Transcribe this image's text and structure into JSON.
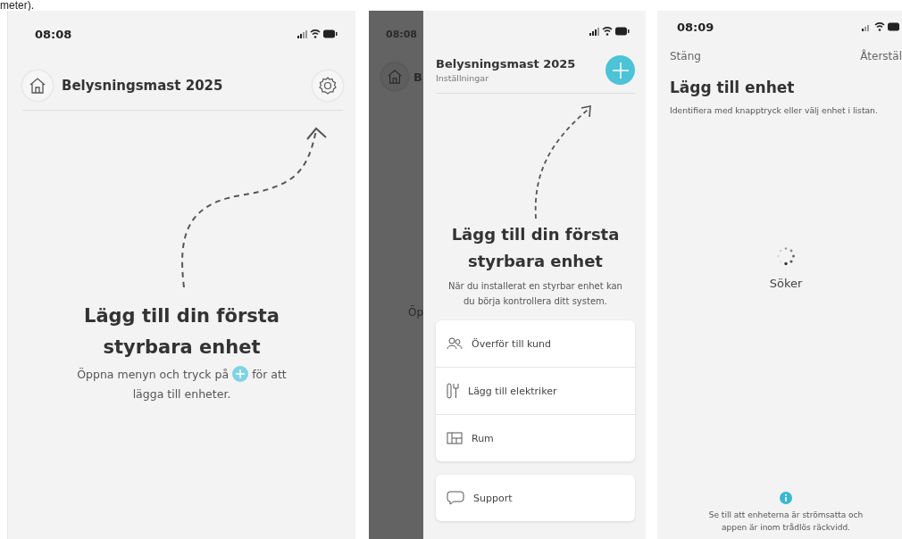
{
  "page_caption": "meter).",
  "screens": [
    {
      "kind": "home",
      "status_time": "08:08",
      "title": "Belysningsmast 2025",
      "heading": "Lägg till din första styrbara enhet",
      "hint_before": "Öppna menyn och tryck på",
      "hint_after": "för att",
      "hint_last": "lägga till enheter."
    },
    {
      "kind": "menu",
      "behind": {
        "status_time": "08:08",
        "title": "B",
        "text": "Öp"
      },
      "title": "Belysningsmast 2025",
      "subtitle": "Inställningar",
      "heading": "Lägg till din första styrbara enhet",
      "description": "När du installerat en styrbar enhet kan du börja kontrollera ditt system.",
      "menu_items": [
        {
          "label": "Överför till kund",
          "kind": "people"
        },
        {
          "label": "Lägg till elektriker",
          "kind": "tools"
        },
        {
          "label": "Rum",
          "kind": "room"
        }
      ],
      "support": {
        "label": "Support"
      }
    },
    {
      "kind": "search",
      "status_time": "08:09",
      "close": "Stäng",
      "reset": "Återstäl",
      "title": "Lägg till enhet",
      "subtitle": "Identifiera med knapptryck eller välj enhet i listan.",
      "status": "Söker",
      "note": "Se till att enheterna är strömsatta och appen är inom trådlös räckvidd."
    }
  ]
}
